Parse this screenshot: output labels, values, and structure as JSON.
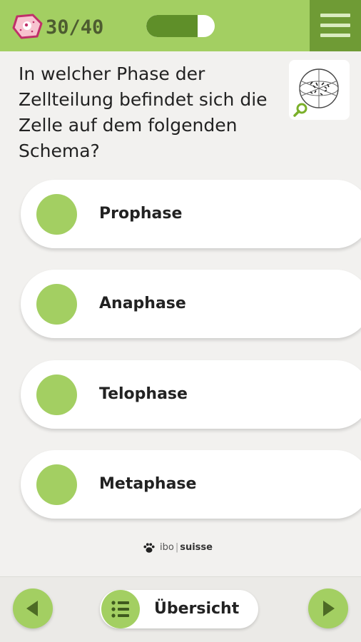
{
  "header": {
    "counter": "30/40",
    "progress": 0.75,
    "cell_icon": "cell-icon",
    "menu_icon": "hamburger-menu-icon"
  },
  "question": {
    "text": "In welcher Phase der Zellteilung befindet sich die Zelle auf dem folgenden Schema?",
    "thumbnail_icon": "schema-thumbnail",
    "zoom_icon": "magnifier-icon"
  },
  "answers": [
    {
      "label": "Prophase"
    },
    {
      "label": "Anaphase"
    },
    {
      "label": "Telophase"
    },
    {
      "label": "Metaphase"
    }
  ],
  "brand": {
    "ibo": "ibo",
    "separator": "|",
    "suisse": "suisse"
  },
  "bottom_bar": {
    "overview_label": "Übersicht",
    "prev_icon": "arrow-left-icon",
    "next_icon": "arrow-right-icon",
    "list_icon": "list-icon"
  },
  "colors": {
    "accent": "#a3cf62",
    "accent_dark": "#6f9b35",
    "progress_fill": "#5f8f29",
    "background": "#f2f1ef"
  }
}
